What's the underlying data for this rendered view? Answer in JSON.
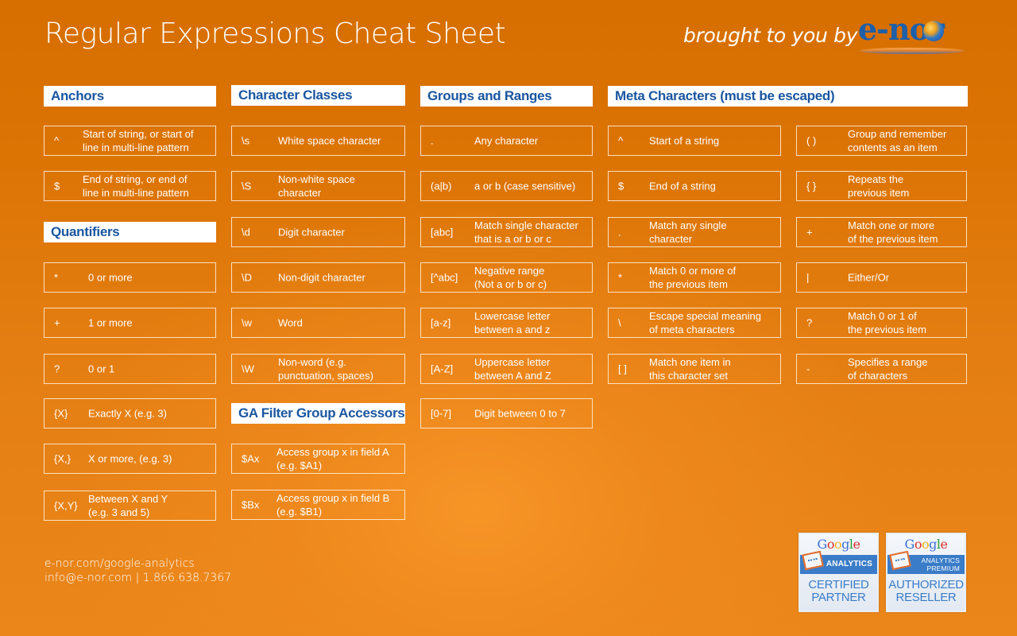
{
  "header": {
    "title": "Regular Expressions Cheat Sheet",
    "brought_by": "brought to you by",
    "logo_text": "e-nor"
  },
  "colors": {
    "background": "#dc7404",
    "header_text": "#1a56a0",
    "header_bg": "#ffffff",
    "box_border": "#ffebd2",
    "logo_blue": "#1f5fa8"
  },
  "sections": {
    "anchors": {
      "title": "Anchors",
      "items": [
        {
          "symbol": "^",
          "desc": "Start of string, or start of\nline in multi-line pattern"
        },
        {
          "symbol": "$",
          "desc": "End of string, or end of\nline in multi-line pattern"
        }
      ]
    },
    "quantifiers": {
      "title": "Quantifiers",
      "items": [
        {
          "symbol": "*",
          "desc": "0 or more"
        },
        {
          "symbol": "+",
          "desc": "1 or more"
        },
        {
          "symbol": "?",
          "desc": "0 or 1"
        },
        {
          "symbol": "{X}",
          "desc": "Exactly X (e.g. 3)"
        },
        {
          "symbol": "{X,}",
          "desc": "X or more, (e.g. 3)"
        },
        {
          "symbol": "{X,Y}",
          "desc": "Between X and Y\n(e.g. 3 and 5)"
        }
      ]
    },
    "character_classes": {
      "title": "Character Classes",
      "items": [
        {
          "symbol": "\\s",
          "desc": "White space character"
        },
        {
          "symbol": "\\S",
          "desc": "Non-white space\ncharacter"
        },
        {
          "symbol": "\\d",
          "desc": "Digit character"
        },
        {
          "symbol": "\\D",
          "desc": "Non-digit character"
        },
        {
          "symbol": "\\w",
          "desc": "Word"
        },
        {
          "symbol": "\\W",
          "desc": "Non-word (e.g.\npunctuation, spaces)"
        }
      ]
    },
    "ga_filter": {
      "title": "GA Filter Group Accessors",
      "items": [
        {
          "symbol": "$Ax",
          "desc": "Access group x in field A\n(e.g. $A1)"
        },
        {
          "symbol": "$Bx",
          "desc": "Access group x in field B\n(e.g. $B1)"
        }
      ]
    },
    "groups_ranges": {
      "title": "Groups and Ranges",
      "items": [
        {
          "symbol": ".",
          "desc": "Any character"
        },
        {
          "symbol": "(a|b)",
          "desc": "a or b (case sensitive)"
        },
        {
          "symbol": "[abc]",
          "desc": "Match single character\nthat is a or b or c"
        },
        {
          "symbol": "[^abc]",
          "desc": "Negative range\n(Not a or b or c)"
        },
        {
          "symbol": "[a-z]",
          "desc": "Lowercase letter\nbetween a and z"
        },
        {
          "symbol": "[A-Z]",
          "desc": "Uppercase letter\nbetween A and Z"
        },
        {
          "symbol": "[0-7]",
          "desc": "Digit between 0 to 7"
        }
      ]
    },
    "meta": {
      "title": "Meta Characters (must be escaped)",
      "left": [
        {
          "symbol": "^",
          "desc": "Start of a string"
        },
        {
          "symbol": "$",
          "desc": "End of a string"
        },
        {
          "symbol": ".",
          "desc": "Match any single\ncharacter"
        },
        {
          "symbol": "*",
          "desc": "Match 0 or more of\nthe previous item"
        },
        {
          "symbol": "\\",
          "desc": "Escape special meaning\nof meta characters"
        },
        {
          "symbol": "[ ]",
          "desc": "Match one item in\nthis character set"
        }
      ],
      "right": [
        {
          "symbol": "( )",
          "desc": "Group and remember\ncontents as an item"
        },
        {
          "symbol": "{ }",
          "desc": "Repeats the\nprevious item"
        },
        {
          "symbol": "+",
          "desc": "Match one or more\nof the previous item"
        },
        {
          "symbol": "|",
          "desc": "Either/Or"
        },
        {
          "symbol": "?",
          "desc": "Match 0 or 1 of\nthe previous item"
        },
        {
          "symbol": "-",
          "desc": "Specifies a range\nof characters"
        }
      ]
    }
  },
  "footer": {
    "url": "e-nor.com/google-analytics",
    "contact": "info@e-nor.com | 1.866.638.7367"
  },
  "badges": [
    {
      "brand": "Google",
      "band": "ANALYTICS",
      "label": "CERTIFIED\nPARTNER"
    },
    {
      "brand": "Google",
      "band": "ANALYTICS\nPREMIUM",
      "label": "AUTHORIZED\nRESELLER"
    }
  ]
}
